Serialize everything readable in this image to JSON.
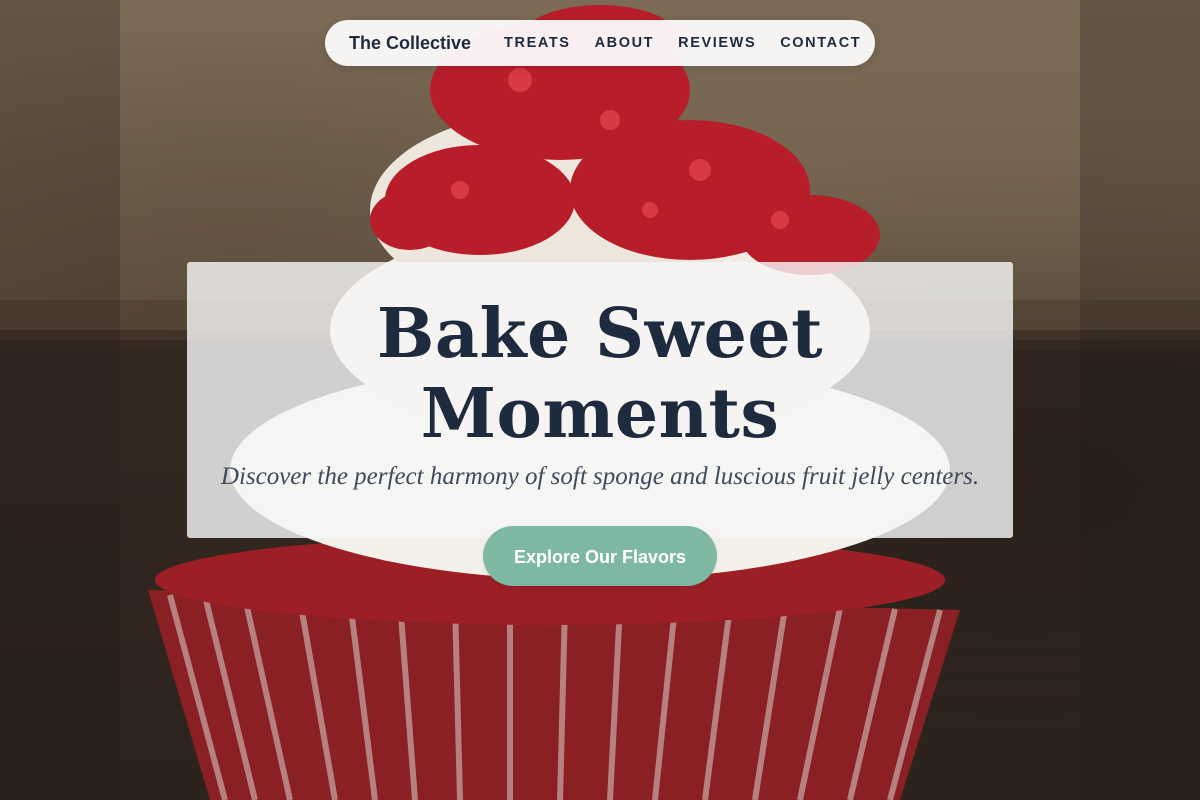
{
  "nav": {
    "brand": "The Collective",
    "links": [
      "TREATS",
      "ABOUT",
      "REVIEWS",
      "CONTACT"
    ]
  },
  "hero": {
    "title": "Bake Sweet Moments",
    "subtitle": "Discover the perfect harmony of soft sponge and luscious fruit jelly centers.",
    "cta_label": "Explore Our Flavors",
    "background_image": "red-velvet-cupcake-photo"
  },
  "colors": {
    "text_dark": "#1e2a3e",
    "cta": "#7fb8a2",
    "card_bg": "#f5f5f5"
  }
}
